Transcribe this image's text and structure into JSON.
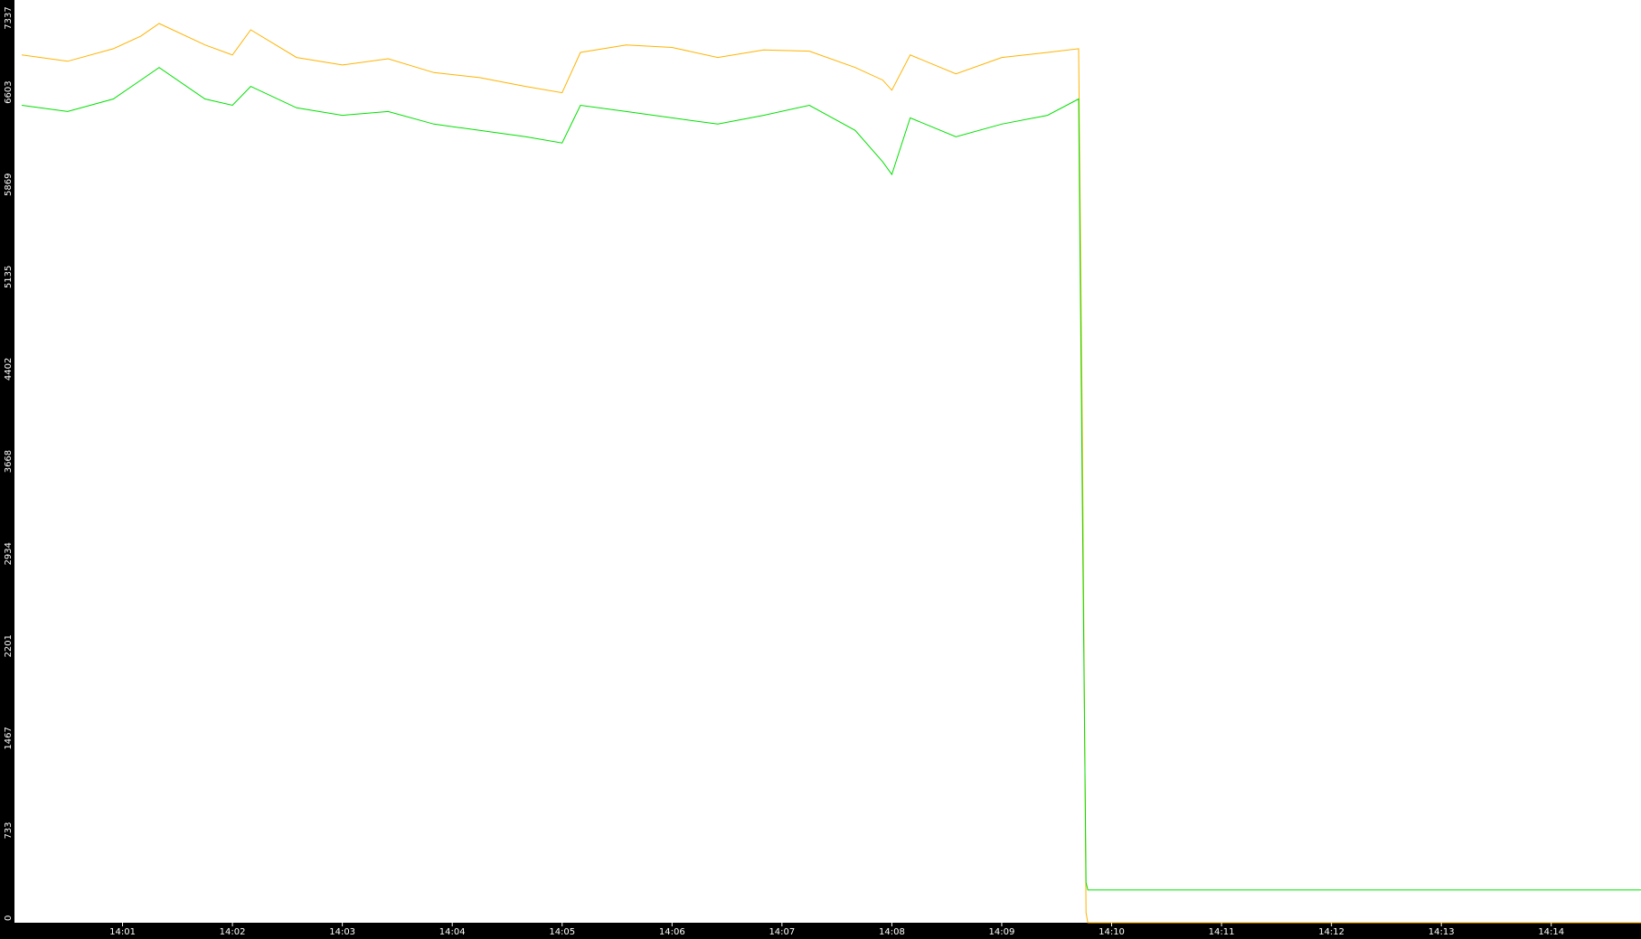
{
  "chart_data": {
    "type": "line",
    "title": "",
    "xlabel": "",
    "ylabel": "",
    "grid": false,
    "legend": "none",
    "colors": {
      "background": "#000000",
      "plot_area": "#ffffff",
      "axis_text": "#ffffff",
      "series_1": "#ffb300",
      "series_2": "#00e000"
    },
    "y_ticks": [
      {
        "value": 0,
        "label": "0"
      },
      {
        "value": 733,
        "label": "733"
      },
      {
        "value": 1467,
        "label": "1467"
      },
      {
        "value": 2201,
        "label": "2201"
      },
      {
        "value": 2934,
        "label": "2934"
      },
      {
        "value": 3668,
        "label": "3668"
      },
      {
        "value": 4402,
        "label": "4402"
      },
      {
        "value": 5135,
        "label": "5135"
      },
      {
        "value": 5869,
        "label": "5869"
      },
      {
        "value": 6603,
        "label": "6603"
      },
      {
        "value": 7337,
        "label": "7337"
      }
    ],
    "x_ticks": [
      "14:01",
      "14:02",
      "14:03",
      "14:04",
      "14:05",
      "14:06",
      "14:07",
      "14:08",
      "14:09",
      "14:10",
      "14:11",
      "14:12",
      "14:13",
      "14:14"
    ],
    "xlim": [
      "14:00:01",
      "14:14:49"
    ],
    "ylim": [
      0,
      7337
    ],
    "series": [
      {
        "color": "#ffb300",
        "x": [
          "14:00:05",
          "14:00:30",
          "14:00:55",
          "14:01:10",
          "14:01:20",
          "14:01:45",
          "14:02:00",
          "14:02:10",
          "14:02:35",
          "14:03:00",
          "14:03:25",
          "14:03:50",
          "14:04:15",
          "14:04:40",
          "14:05:00",
          "14:05:10",
          "14:05:35",
          "14:06:00",
          "14:06:25",
          "14:06:50",
          "14:07:15",
          "14:07:40",
          "14:07:55",
          "14:08:00",
          "14:08:10",
          "14:08:35",
          "14:09:00",
          "14:09:25",
          "14:09:42",
          "14:09:44",
          "14:09:46",
          "14:09:47",
          "14:14:49"
        ],
        "y": [
          6900,
          6850,
          6950,
          7050,
          7150,
          6980,
          6900,
          7100,
          6880,
          6820,
          6870,
          6760,
          6720,
          6650,
          6600,
          6920,
          6980,
          6960,
          6880,
          6940,
          6930,
          6800,
          6700,
          6620,
          6900,
          6750,
          6880,
          6920,
          6950,
          3900,
          80,
          0,
          0
        ]
      },
      {
        "color": "#00e000",
        "x": [
          "14:00:05",
          "14:00:30",
          "14:00:55",
          "14:01:10",
          "14:01:20",
          "14:01:45",
          "14:02:00",
          "14:02:10",
          "14:02:35",
          "14:03:00",
          "14:03:25",
          "14:03:50",
          "14:04:15",
          "14:04:40",
          "14:05:00",
          "14:05:10",
          "14:05:35",
          "14:06:00",
          "14:06:25",
          "14:06:50",
          "14:07:15",
          "14:07:40",
          "14:07:55",
          "14:08:00",
          "14:08:10",
          "14:08:35",
          "14:09:00",
          "14:09:25",
          "14:09:42",
          "14:09:44",
          "14:09:46",
          "14:09:47",
          "14:14:49"
        ],
        "y": [
          6500,
          6450,
          6550,
          6700,
          6800,
          6550,
          6500,
          6650,
          6480,
          6420,
          6450,
          6350,
          6300,
          6250,
          6200,
          6500,
          6450,
          6400,
          6350,
          6420,
          6500,
          6300,
          6050,
          5950,
          6400,
          6250,
          6350,
          6420,
          6550,
          3350,
          320,
          260,
          260
        ]
      }
    ]
  }
}
